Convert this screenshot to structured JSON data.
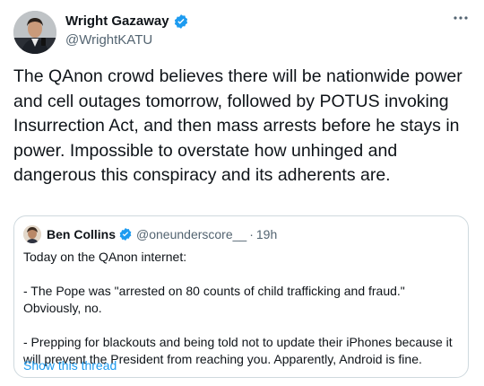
{
  "author": {
    "name": "Wright Gazaway",
    "handle": "@WrightKATU"
  },
  "more_icon": "more-horizontal-icon",
  "tweet": {
    "text": "The QAnon crowd believes there will be nationwide power and cell outages tomorrow, followed by POTUS invoking Insurrection Act, and then mass arrests before he stays in power. Impossible to overstate how unhinged and dangerous this conspiracy and its adherents are."
  },
  "quote": {
    "name": "Ben Collins",
    "handle": "@oneunderscore__",
    "separator": "·",
    "time": "19h",
    "lines": [
      "Today on the QAnon internet:",
      "- The Pope was \"arrested on 80 counts of child trafficking and fraud.\" Obviously, no.",
      "- Prepping for blackouts and being told not to update their iPhones because it will prevent the President from reaching you. Apparently, Android is fine."
    ],
    "show_thread": "Show this thread"
  },
  "colors": {
    "text": "#0f1419",
    "secondary": "#536471",
    "link": "#1d9bf0",
    "border": "#cfd9de",
    "verified": "#1d9bf0"
  }
}
